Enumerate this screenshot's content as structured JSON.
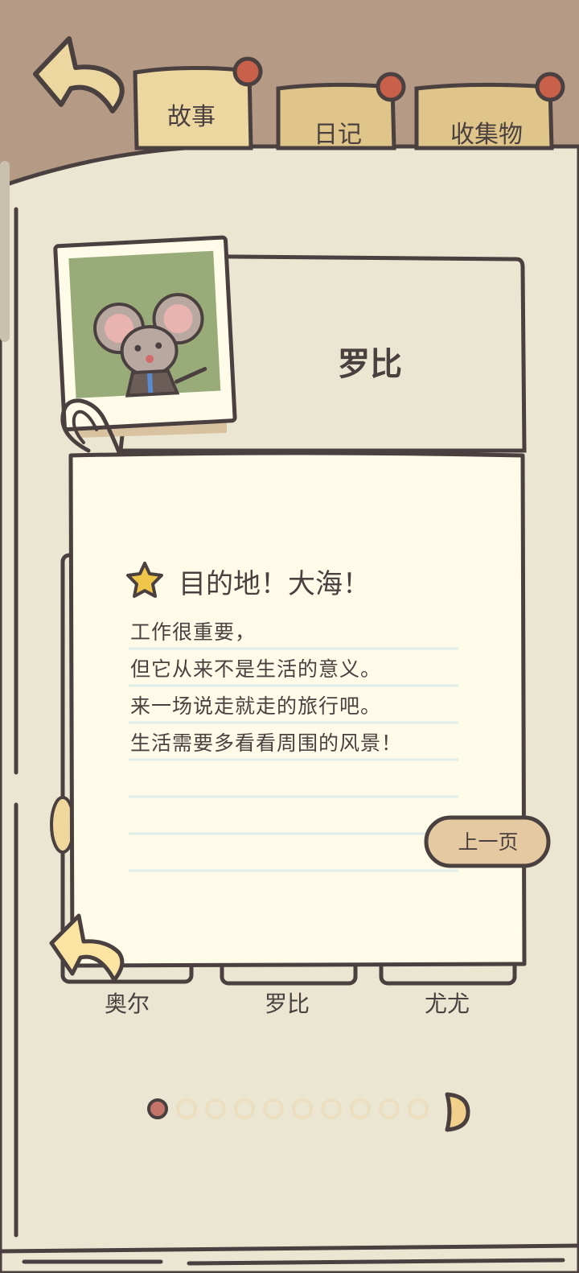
{
  "tabs": [
    {
      "label": "故事",
      "active": true
    },
    {
      "label": "日记",
      "active": false
    },
    {
      "label": "收集物",
      "active": false
    }
  ],
  "character": {
    "name": "罗比"
  },
  "note": {
    "title": "目的地！大海！",
    "lines": [
      "工作很重要，",
      "但它从来不是生活的意义。",
      "来一场说走就走的旅行吧。",
      "生活需要多看看周围的风景！"
    ],
    "prev_button": "上一页"
  },
  "characters": [
    "奥尔",
    "罗比",
    "尤尤"
  ],
  "pagination": {
    "total": 10,
    "current": 1
  },
  "colors": {
    "background": "#b59a86",
    "book": "#ebe6d2",
    "note": "#fefbe8",
    "tab": "#ecd7a0",
    "pin": "#c9604a",
    "outline": "#4a4040",
    "button": "#e5c9a0",
    "dot_active": "#c47468",
    "dot_inactive": "#ecdfbf"
  },
  "icons": {
    "back": "curved-back-arrow-icon",
    "star": "star-icon",
    "next": "half-circle-next-icon",
    "clip": "paperclip-icon"
  }
}
